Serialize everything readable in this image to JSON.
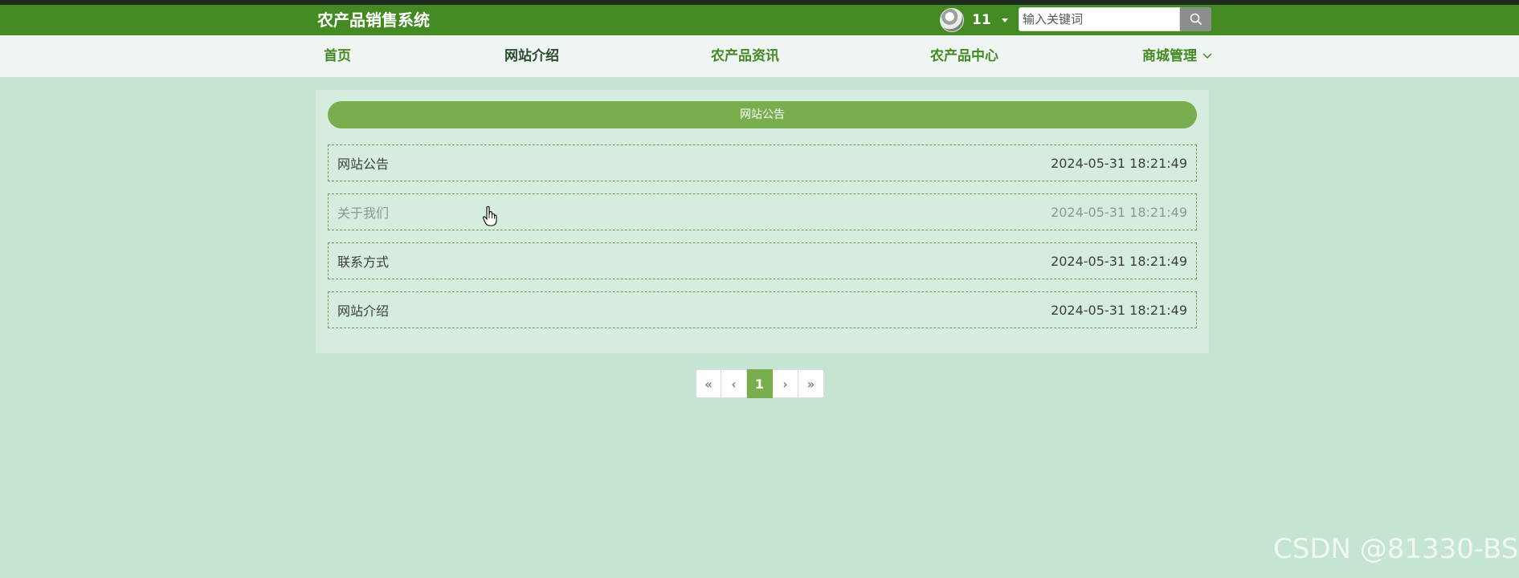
{
  "header": {
    "site_title": "农产品销售系统",
    "username": "11",
    "search_placeholder": "输入关键词"
  },
  "nav": {
    "items": [
      {
        "label": "首页"
      },
      {
        "label": "网站介绍"
      },
      {
        "label": "农产品资讯"
      },
      {
        "label": "农产品中心"
      },
      {
        "label": "商城管理"
      }
    ]
  },
  "panel": {
    "title": "网站公告",
    "items": [
      {
        "title": "网站公告",
        "date": "2024-05-31 18:21:49"
      },
      {
        "title": "关于我们",
        "date": "2024-05-31 18:21:49"
      },
      {
        "title": "联系方式",
        "date": "2024-05-31 18:21:49"
      },
      {
        "title": "网站介绍",
        "date": "2024-05-31 18:21:49"
      }
    ]
  },
  "pagination": {
    "first": "«",
    "prev": "‹",
    "current": "1",
    "next": "›",
    "last": "»"
  },
  "watermark": "CSDN @81330-BS",
  "colors": {
    "header": "#438a23",
    "accent": "#79ae4e",
    "background": "#c5e4d1"
  }
}
